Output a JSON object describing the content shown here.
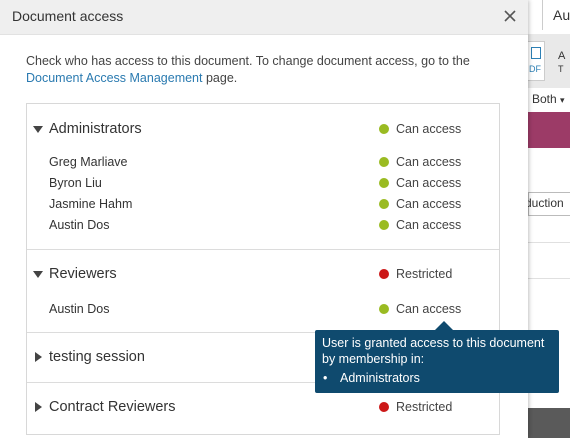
{
  "background_app": {
    "top_text": "Au",
    "pdf_label": "DF",
    "tool_label_1": "A",
    "tool_label_2": "T",
    "filter_value": "Both",
    "field_text": "duction"
  },
  "dialog": {
    "title": "Document access",
    "intro_text": "Check who has access to this document. To change document access, go to the",
    "intro_link": "Document Access Management",
    "intro_suffix": " page."
  },
  "groups": [
    {
      "name": "Administrators",
      "expanded": true,
      "status": "Can access",
      "status_color": "#9abb22",
      "members": [
        {
          "name": "Greg Marliave",
          "status": "Can access"
        },
        {
          "name": "Byron Liu",
          "status": "Can access"
        },
        {
          "name": "Jasmine Hahm",
          "status": "Can access"
        },
        {
          "name": "Austin Dos",
          "status": "Can access"
        }
      ]
    },
    {
      "name": "Reviewers",
      "expanded": true,
      "status": "Restricted",
      "status_color": "#cc1818",
      "members": [
        {
          "name": "Austin Dos",
          "status": "Can access"
        }
      ]
    },
    {
      "name": "testing session",
      "expanded": false
    },
    {
      "name": "Contract Reviewers",
      "expanded": false,
      "status": "Restricted",
      "status_color": "#cc1818"
    }
  ],
  "tooltip": {
    "line1": "User is granted access to this document",
    "line2": "by membership in:",
    "bullet": "•",
    "items": [
      "Administrators"
    ]
  },
  "colors": {
    "can_access": "#9abb22",
    "restricted": "#cc1818",
    "link": "#2a7ab0",
    "tooltip_bg": "#0f4a6e",
    "header_bg": "#efefef"
  }
}
